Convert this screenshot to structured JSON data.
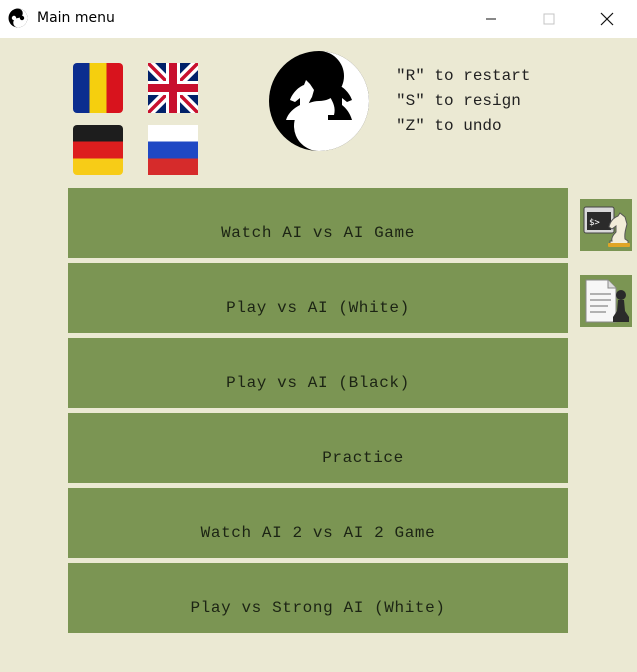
{
  "window": {
    "title": "Main menu",
    "app_icon": "yin-yang-chess-icon",
    "controls": [
      "minimize-icon",
      "maximize-icon",
      "close-icon"
    ]
  },
  "flags": [
    {
      "name": "romania-flag-icon",
      "colors": [
        "#0b2d8f",
        "#f5cf0e",
        "#d8131d"
      ]
    },
    {
      "name": "uk-flag-icon",
      "colors": [
        "#012169",
        "#ffffff",
        "#c8102e"
      ]
    },
    {
      "name": "germany-flag-icon",
      "colors": [
        "#1d1d1d",
        "#dd1e1e",
        "#f7cc17"
      ]
    },
    {
      "name": "russia-flag-icon",
      "colors": [
        "#ffffff",
        "#1f48c4",
        "#d62b2b"
      ]
    }
  ],
  "logo": "yin-yang-knights-logo",
  "hotkeys": [
    "\"R\" to restart",
    "\"S\" to resign",
    "\"Z\" to undo"
  ],
  "menu": [
    "Watch AI vs AI Game",
    "Play vs AI (White)",
    "Play vs AI (Black)",
    "Practice",
    "Watch AI 2 vs AI 2 Game",
    "Play vs Strong AI (White)"
  ],
  "side_buttons": [
    "console-knight-icon",
    "document-pawn-icon"
  ],
  "colors": {
    "background": "#ebe9d3",
    "button": "#7b9553",
    "button_text": "#1c2414"
  }
}
